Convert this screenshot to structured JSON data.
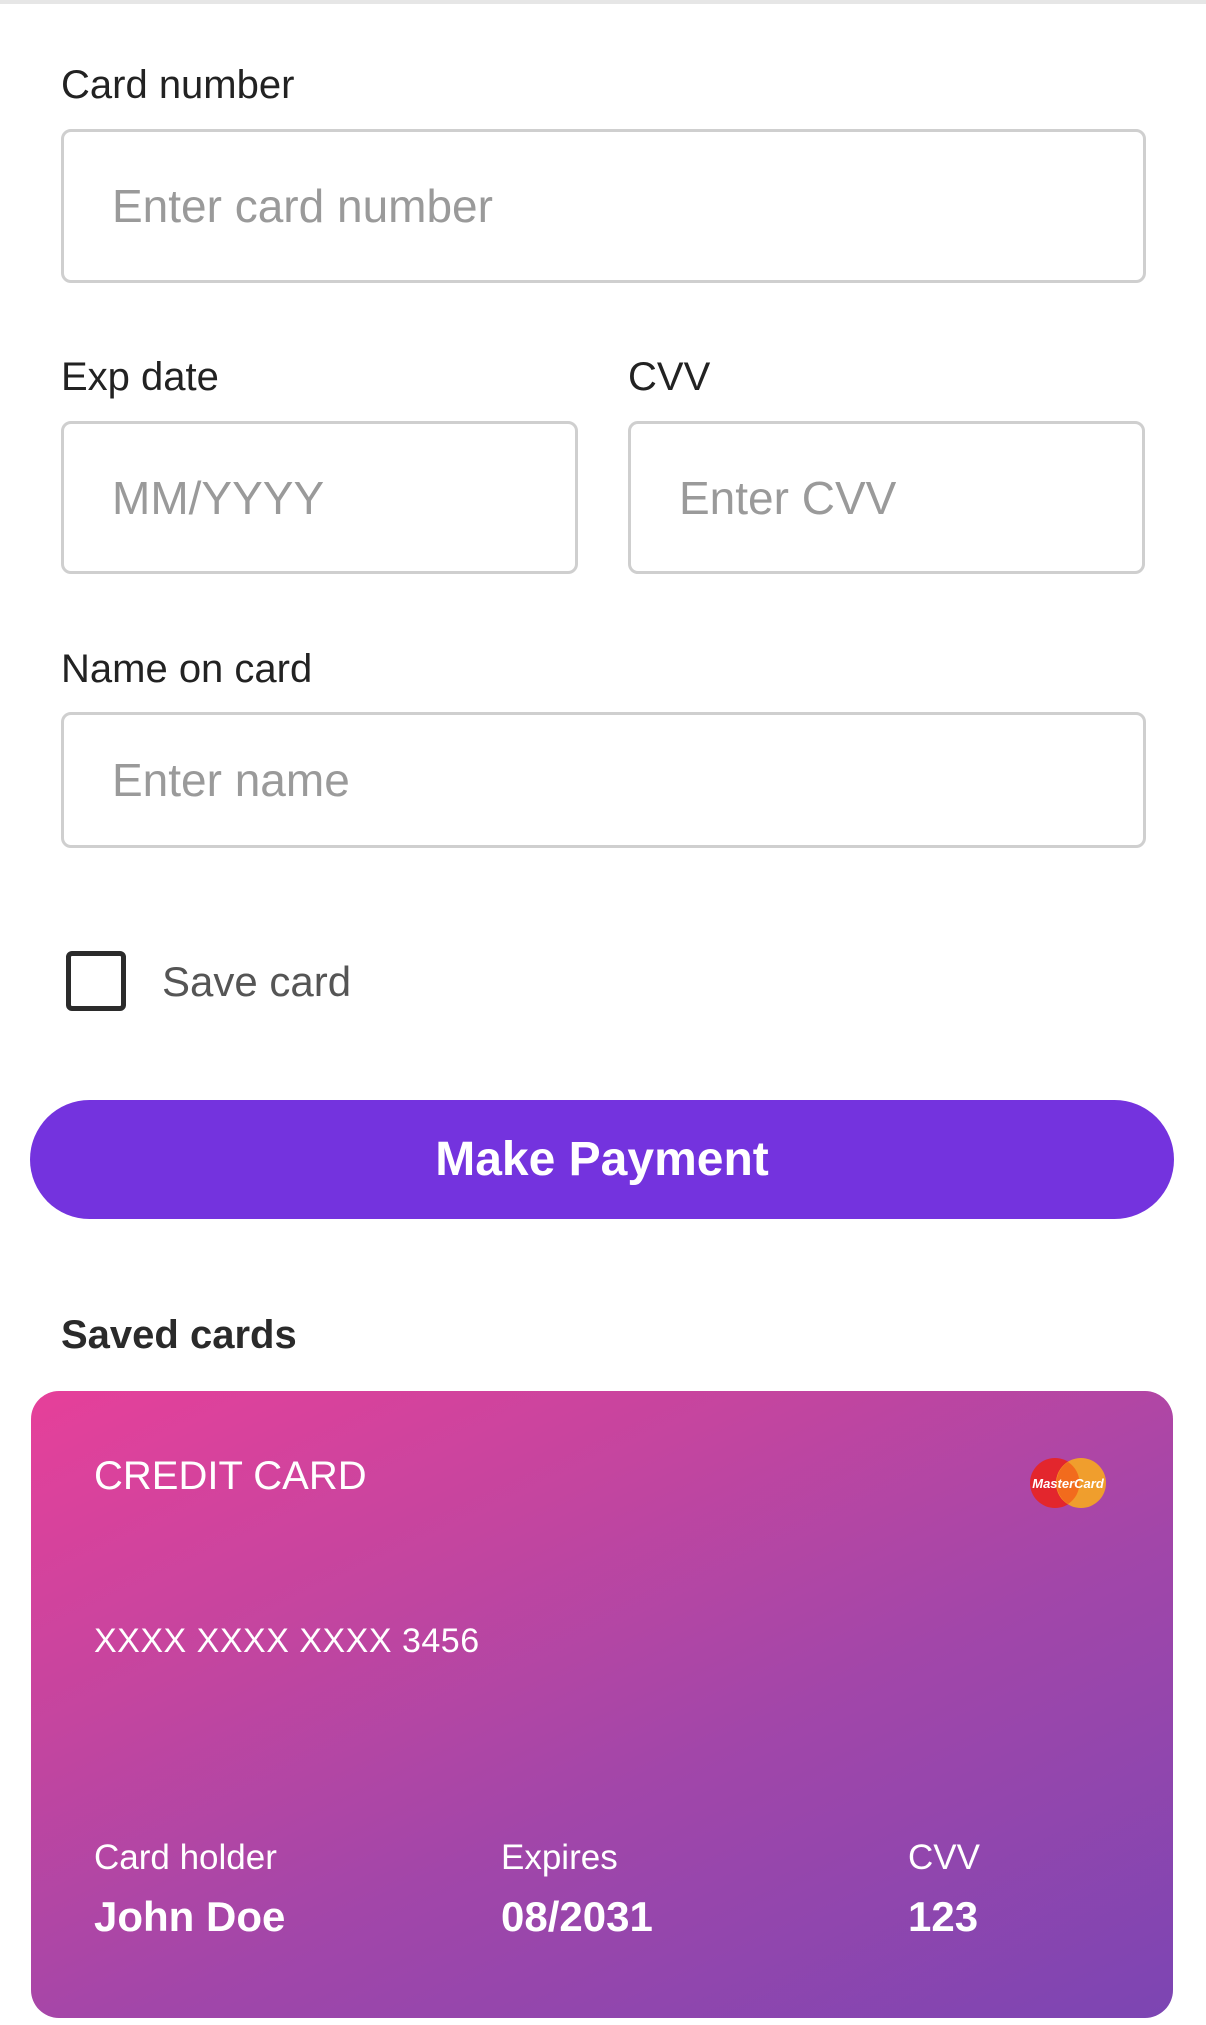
{
  "form": {
    "card_number_label": "Card number",
    "card_number_placeholder": "Enter card number",
    "exp_date_label": "Exp date",
    "exp_date_placeholder": "MM/YYYY",
    "cvv_label": "CVV",
    "cvv_placeholder": "Enter CVV",
    "name_label": "Name on card",
    "name_placeholder": "Enter name",
    "save_card_label": "Save card",
    "save_card_checked": false,
    "pay_button_label": "Make Payment"
  },
  "colors": {
    "accent": "#7433de",
    "card_gradient_start": "#e6409a",
    "card_gradient_end": "#7c45b3"
  },
  "saved_cards": {
    "title": "Saved cards",
    "cards": [
      {
        "type": "CREDIT CARD",
        "brand_icon": "mastercard-logo-icon",
        "brand_text": "MasterCard",
        "number": "XXXX XXXX XXXX 3456",
        "holder_label": "Card holder",
        "holder": "John Doe",
        "expires_label": "Expires",
        "expires": "08/2031",
        "cvv_label": "CVV",
        "cvv": "123"
      }
    ]
  }
}
